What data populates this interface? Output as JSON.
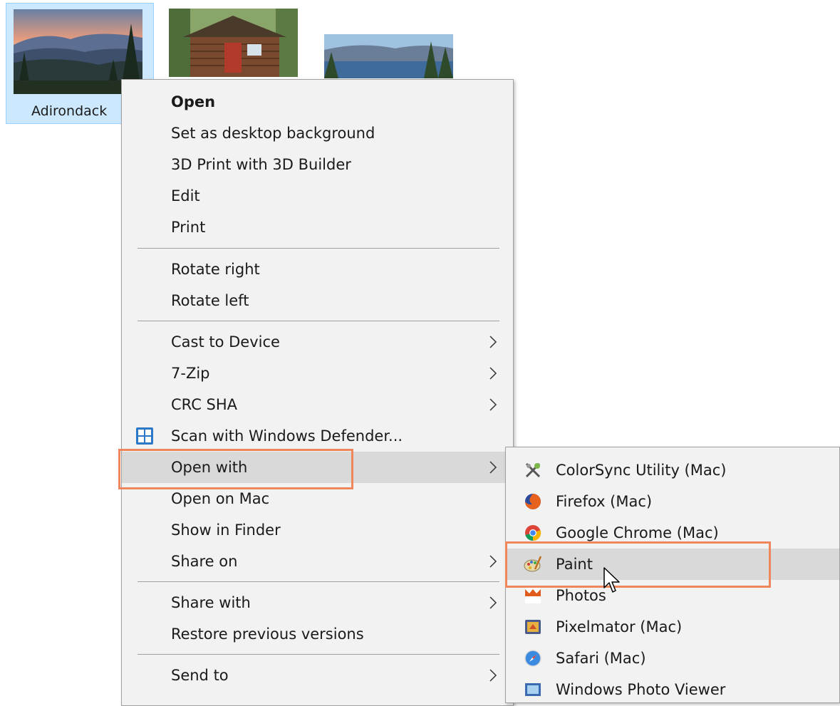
{
  "desktop": {
    "selected_file_label": "Adirondack"
  },
  "menu": {
    "items": [
      {
        "label": "Open"
      },
      {
        "label": "Set as desktop background"
      },
      {
        "label": "3D Print with 3D Builder"
      },
      {
        "label": "Edit"
      },
      {
        "label": "Print"
      },
      {
        "label": "Rotate right"
      },
      {
        "label": "Rotate left"
      },
      {
        "label": "Cast to Device"
      },
      {
        "label": "7-Zip"
      },
      {
        "label": "CRC SHA"
      },
      {
        "label": "Scan with Windows Defender..."
      },
      {
        "label": "Open with"
      },
      {
        "label": "Open on Mac"
      },
      {
        "label": "Show in Finder"
      },
      {
        "label": "Share on"
      },
      {
        "label": "Share with"
      },
      {
        "label": "Restore previous versions"
      },
      {
        "label": "Send to"
      }
    ]
  },
  "submenu": {
    "items": [
      {
        "label": "ColorSync Utility (Mac)",
        "icon": "colorsync-icon"
      },
      {
        "label": "Firefox (Mac)",
        "icon": "firefox-icon"
      },
      {
        "label": "Google Chrome (Mac)",
        "icon": "chrome-icon"
      },
      {
        "label": "Paint",
        "icon": "paint-palette-icon"
      },
      {
        "label": "Photos",
        "icon": "photos-icon"
      },
      {
        "label": "Pixelmator (Mac)",
        "icon": "pixelmator-icon"
      },
      {
        "label": "Safari (Mac)",
        "icon": "safari-icon"
      },
      {
        "label": "Windows Photo Viewer",
        "icon": "photo-viewer-icon"
      }
    ]
  },
  "colors": {
    "highlight": "#f0875c",
    "menu_bg": "#f2f2f2",
    "hover_bg": "#d9d9d9",
    "selection_bg": "#cce8ff"
  }
}
